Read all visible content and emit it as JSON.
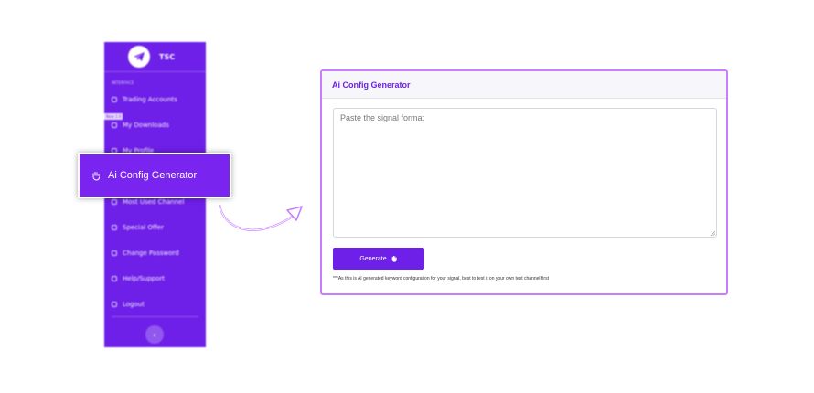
{
  "sidebar": {
    "brand": "TSC",
    "section_label": "INTERFACE",
    "badge": "New 1.0",
    "items": [
      {
        "label": "Trading Accounts"
      },
      {
        "label": "My Downloads"
      },
      {
        "label": "My Profile"
      },
      {
        "label": "Most Used Channel"
      },
      {
        "label": "Special Offer"
      },
      {
        "label": "Change Password"
      },
      {
        "label": "Help/Support"
      },
      {
        "label": "Logout"
      }
    ],
    "collapse_glyph": "‹"
  },
  "highlight": {
    "label": "Ai Config Generator"
  },
  "panel": {
    "title": "Ai Config Generator",
    "textarea_placeholder": "Paste the signal format",
    "generate_label": "Generate",
    "note": "***As this is AI generated keyword configuration for your signal, best to test it on your own test channel first"
  },
  "colors": {
    "accent": "#6e1fe8",
    "panel_border": "#c77dff",
    "arrow": "#c77dff"
  }
}
